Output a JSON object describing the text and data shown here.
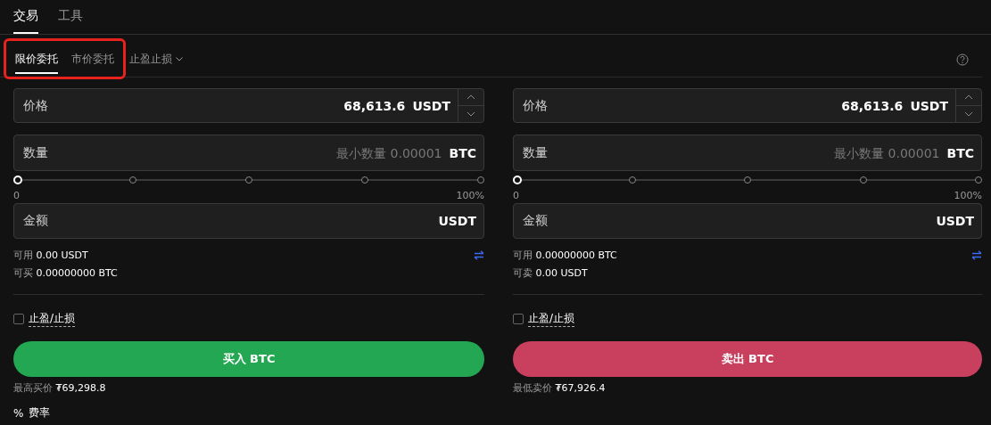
{
  "tabs": [
    {
      "label": "交易",
      "selected": true
    },
    {
      "label": "工具",
      "selected": false
    }
  ],
  "order_types": [
    {
      "label": "限价委托",
      "selected": true,
      "kind": "tab"
    },
    {
      "label": "市价委托",
      "selected": false,
      "kind": "tab"
    },
    {
      "label": "止盈止损",
      "selected": false,
      "kind": "dropdown"
    }
  ],
  "highlight_frame": true,
  "panels": [
    {
      "kind": "buy",
      "price_field": {
        "label": "价格",
        "value": "68,613.6",
        "unit": "USDT"
      },
      "quantity_field": {
        "label": "数量",
        "placeholder": "最小数量 0.00001",
        "unit": "BTC"
      },
      "slider": {
        "level": 0,
        "min_label": "0",
        "max_label": "100%"
      },
      "amount_field": {
        "label": "金额",
        "unit": "USDT"
      },
      "available": {
        "label": "可用",
        "value": "0.00 USDT"
      },
      "max_trade": {
        "label": "可买",
        "value": "0.00000000 BTC"
      },
      "tp_sl": {
        "label": "止盈/止损",
        "checked": false
      },
      "action_button": "买入 BTC",
      "best_price": {
        "label": "最高买价",
        "value": "₮69,298.8"
      }
    },
    {
      "kind": "sell",
      "price_field": {
        "label": "价格",
        "value": "68,613.6",
        "unit": "USDT"
      },
      "quantity_field": {
        "label": "数量",
        "placeholder": "最小数量 0.00001",
        "unit": "BTC"
      },
      "slider": {
        "level": 0,
        "min_label": "0",
        "max_label": "100%"
      },
      "amount_field": {
        "label": "金额",
        "unit": "USDT"
      },
      "available": {
        "label": "可用",
        "value": "0.00000000 BTC"
      },
      "max_trade": {
        "label": "可卖",
        "value": "0.00 USDT"
      },
      "tp_sl": {
        "label": "止盈/止损",
        "checked": false
      },
      "action_button": "卖出 BTC",
      "best_price": {
        "label": "最低卖价",
        "value": "₮67,926.4"
      }
    }
  ],
  "fee": {
    "symbol": "%",
    "label": "费率"
  }
}
